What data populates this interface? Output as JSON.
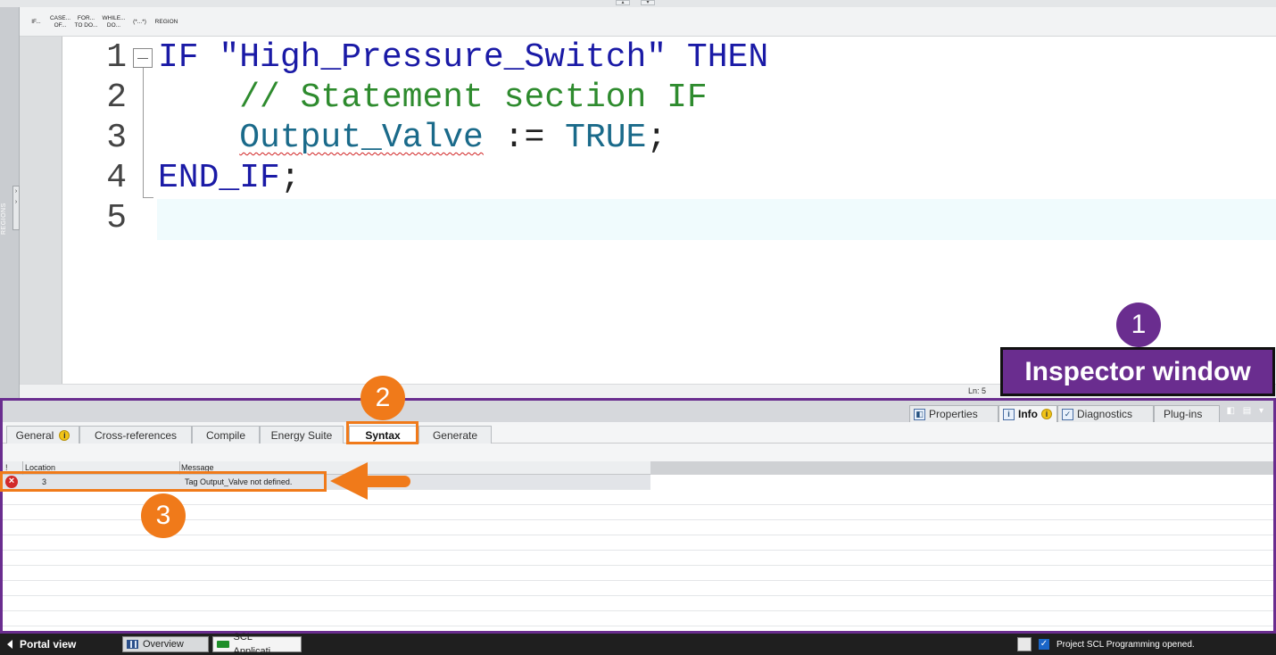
{
  "toolbar": {
    "buttons": [
      "IF...",
      "CASE...\nOF...",
      "FOR...\nTO DO...",
      "WHILE...\nDO...",
      "(*...*)",
      "REGION"
    ]
  },
  "regions_panel": {
    "label": "REGIONS"
  },
  "editor": {
    "lines": [
      {
        "number": "1",
        "tokens": [
          {
            "t": "IF ",
            "c": "kw"
          },
          {
            "t": "\"High_Pressure_Switch\"",
            "c": "str"
          },
          {
            "t": " THEN",
            "c": "kw"
          }
        ]
      },
      {
        "number": "2",
        "tokens": [
          {
            "t": "    // Statement section IF",
            "c": "cmt"
          }
        ]
      },
      {
        "number": "3",
        "tokens": [
          {
            "t": "    ",
            "c": "op"
          },
          {
            "t": "Output_Valve",
            "c": "tag"
          },
          {
            "t": " := ",
            "c": "op"
          },
          {
            "t": "TRUE",
            "c": "lit"
          },
          {
            "t": ";",
            "c": "op"
          }
        ]
      },
      {
        "number": "4",
        "tokens": [
          {
            "t": "END_IF",
            "c": "kw"
          },
          {
            "t": ";",
            "c": "op"
          }
        ]
      },
      {
        "number": "5",
        "tokens": []
      }
    ],
    "status_line": "Ln: 5"
  },
  "inspector": {
    "tabs": [
      {
        "label": "Properties",
        "icon": "properties-icon",
        "active": false
      },
      {
        "label": "Info",
        "icon": "info-icon",
        "active": true,
        "badge": "i"
      },
      {
        "label": "Diagnostics",
        "icon": "diagnostics-icon",
        "active": false
      },
      {
        "label": "Plug-ins",
        "active": false
      }
    ],
    "subtabs": [
      {
        "label": "General",
        "badge": "i"
      },
      {
        "label": "Cross-references"
      },
      {
        "label": "Compile"
      },
      {
        "label": "Energy Suite"
      },
      {
        "label": "Syntax",
        "active": true
      },
      {
        "label": "Generate"
      }
    ],
    "grid": {
      "columns": [
        "!",
        "Location",
        "Message"
      ],
      "rows": [
        {
          "status": "error",
          "location": "3",
          "message": "Tag Output_Valve not defined."
        }
      ]
    }
  },
  "annotations": {
    "badge_1": "1",
    "badge_2": "2",
    "badge_3": "3",
    "label": "Inspector window",
    "accent_purple": "#6a2d8f",
    "accent_orange": "#f07a1a"
  },
  "taskbar": {
    "portal_view": "Portal view",
    "overview": "Overview",
    "scl_app": "SCL Applicati...",
    "status": "Project SCL Programming opened."
  }
}
